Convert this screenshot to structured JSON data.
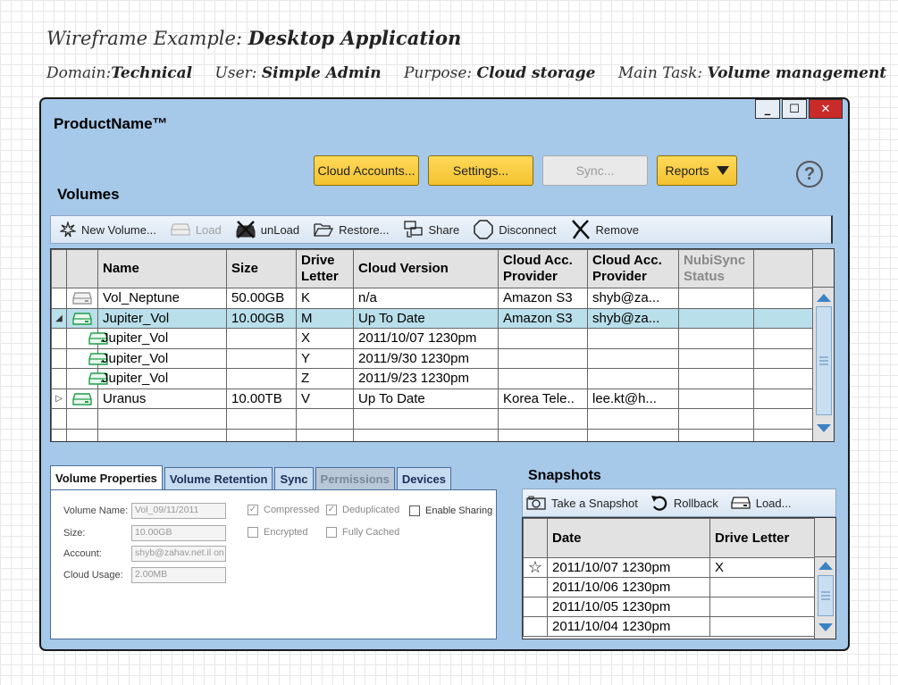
{
  "wireframe": {
    "title_prefix": "Wireframe Example:",
    "title_main": "Desktop Application",
    "meta": [
      {
        "label": "Domain:",
        "value": "Technical"
      },
      {
        "label": "User:",
        "value": "Simple Admin"
      },
      {
        "label": "Purpose:",
        "value": "Cloud storage"
      },
      {
        "label": "Main Task:",
        "value": "Volume management"
      }
    ]
  },
  "window": {
    "product_name": "ProductName™",
    "controls": {
      "minimize": "_",
      "maximize": "☐",
      "close": "✕"
    }
  },
  "actions": {
    "cloud_accounts": "Cloud Accounts...",
    "settings": "Settings...",
    "sync": "Sync...",
    "reports": "Reports",
    "help": "?"
  },
  "volumes": {
    "title": "Volumes",
    "toolbar": [
      {
        "label": "New Volume...",
        "icon": "new-volume-icon",
        "disabled": false
      },
      {
        "label": "Load",
        "icon": "load-disk-icon",
        "disabled": true
      },
      {
        "label": "unLoad",
        "icon": "unload-icon",
        "disabled": false
      },
      {
        "label": "Restore...",
        "icon": "folder-open-icon",
        "disabled": false
      },
      {
        "label": "Share",
        "icon": "share-icon",
        "disabled": false
      },
      {
        "label": "Disconnect",
        "icon": "disconnect-icon",
        "disabled": false
      },
      {
        "label": "Remove",
        "icon": "remove-icon",
        "disabled": false
      }
    ],
    "columns": {
      "name": "Name",
      "size": "Size",
      "drive": "Drive Letter",
      "cloud_version": "Cloud Version",
      "provider1": "Cloud Acc. Provider",
      "provider2": "Cloud Acc. Provider",
      "nubisync": "NubiSync Status"
    },
    "rows": [
      {
        "expander": "",
        "icon": "grey",
        "name": "Vol_Neptune",
        "size": "50.00GB",
        "drive": "K",
        "version": "n/a",
        "provider": "Amazon S3",
        "account": "shyb@za...",
        "status": ""
      },
      {
        "expander": "◢",
        "icon": "green",
        "name": "Jupiter_Vol",
        "size": "10.00GB",
        "drive": "M",
        "version": "Up To Date",
        "provider": "Amazon S3",
        "account": "shyb@za...",
        "status": ""
      },
      {
        "expander": "",
        "icon": "green-sub",
        "name": "Jupiter_Vol",
        "size": "",
        "drive": "X",
        "version": "2011/10/07  1230pm",
        "provider": "",
        "account": "",
        "status": ""
      },
      {
        "expander": "",
        "icon": "green-sub",
        "name": "Jupiter_Vol",
        "size": "",
        "drive": "Y",
        "version": "2011/9/30  1230pm",
        "provider": "",
        "account": "",
        "status": ""
      },
      {
        "expander": "",
        "icon": "green-sub",
        "name": "Jupiter_Vol",
        "size": "",
        "drive": "Z",
        "version": "2011/9/23  1230pm",
        "provider": "",
        "account": "",
        "status": ""
      },
      {
        "expander": "▷",
        "icon": "green",
        "name": "Uranus",
        "size": "10.00TB",
        "drive": "V",
        "version": " Up To Date",
        "provider": "Korea Tele..",
        "account": "lee.kt@h...",
        "status": ""
      },
      {
        "expander": "",
        "icon": "",
        "name": "",
        "size": "",
        "drive": "",
        "version": "",
        "provider": "",
        "account": "",
        "status": ""
      },
      {
        "expander": "",
        "icon": "",
        "name": "",
        "size": "",
        "drive": "",
        "version": "",
        "provider": "",
        "account": "",
        "status": ""
      }
    ]
  },
  "properties": {
    "tabs": [
      {
        "label": "Volume Properties",
        "state": "active"
      },
      {
        "label": "Volume Retention",
        "state": "normal"
      },
      {
        "label": "Sync",
        "state": "normal"
      },
      {
        "label": "Permissions",
        "state": "disabled"
      },
      {
        "label": "Devices",
        "state": "normal"
      }
    ],
    "fields": {
      "volume_name_label": "Volume Name:",
      "volume_name_value": "Vol_09/11/2011",
      "size_label": "Size:",
      "size_value": "10.00GB",
      "account_label": "Account:",
      "account_value": "shyb@zahav.net.il on ...",
      "usage_label": "Cloud Usage:",
      "usage_value": "2.00MB"
    },
    "checks": {
      "compressed": {
        "label": "Compressed",
        "checked": true
      },
      "deduplicated": {
        "label": "Deduplicated",
        "checked": true
      },
      "enable_sharing": {
        "label": "Enable Sharing",
        "checked": false
      },
      "encrypted": {
        "label": "Encrypted",
        "checked": false
      },
      "fully_cached": {
        "label": "Fully Cached",
        "checked": false
      }
    }
  },
  "snapshots": {
    "title": "Snapshots",
    "toolbar": {
      "take": "Take a Snapshot",
      "rollback": "Rollback",
      "load": "Load..."
    },
    "columns": {
      "date": "Date",
      "drive": "Drive Letter"
    },
    "rows": [
      {
        "marker": "☆",
        "date": "2011/10/07  1230pm",
        "drive": "X"
      },
      {
        "marker": "",
        "date": "2011/10/06  1230pm",
        "drive": ""
      },
      {
        "marker": "",
        "date": "2011/10/05  1230pm",
        "drive": ""
      },
      {
        "marker": "",
        "date": "2011/10/04  1230pm",
        "drive": ""
      }
    ]
  }
}
